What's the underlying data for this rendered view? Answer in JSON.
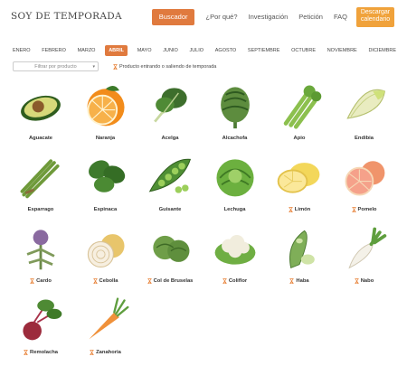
{
  "header": {
    "logo": "SOY DE TEMPORADA",
    "nav": {
      "search": "Buscador",
      "why": "¿Por qué?",
      "research": "Investigación",
      "petition": "Petición",
      "faq": "FAQ",
      "download": "Descargar calendario"
    }
  },
  "months": [
    "ENERO",
    "FEBRERO",
    "MARZO",
    "ABRIL",
    "MAYO",
    "JUNIO",
    "JULIO",
    "AGOSTO",
    "SEPTIEMBRE",
    "OCTUBRE",
    "NOVIEMBRE",
    "DICIEMBRE"
  ],
  "active_month": "ABRIL",
  "filter": {
    "placeholder": "Filtrar por producto"
  },
  "legend": {
    "text": "Producto entrando o saliendo de temporada"
  },
  "products": [
    {
      "name": "Aguacate",
      "transition": false,
      "icon": "avocado-icon"
    },
    {
      "name": "Naranja",
      "transition": false,
      "icon": "orange-icon"
    },
    {
      "name": "Acelga",
      "transition": false,
      "icon": "chard-icon"
    },
    {
      "name": "Alcachofa",
      "transition": false,
      "icon": "artichoke-icon"
    },
    {
      "name": "Apio",
      "transition": false,
      "icon": "celery-icon"
    },
    {
      "name": "Endibia",
      "transition": false,
      "icon": "endive-icon"
    },
    {
      "name": "Esparrago",
      "transition": false,
      "icon": "asparagus-icon"
    },
    {
      "name": "Espinaca",
      "transition": false,
      "icon": "spinach-icon"
    },
    {
      "name": "Guisante",
      "transition": false,
      "icon": "pea-icon"
    },
    {
      "name": "Lechuga",
      "transition": false,
      "icon": "lettuce-icon"
    },
    {
      "name": "Limón",
      "transition": true,
      "icon": "lemon-icon"
    },
    {
      "name": "Pomelo",
      "transition": true,
      "icon": "grapefruit-icon"
    },
    {
      "name": "Cardo",
      "transition": true,
      "icon": "thistle-icon"
    },
    {
      "name": "Cebolla",
      "transition": true,
      "icon": "onion-icon"
    },
    {
      "name": "Col de Bruselas",
      "transition": true,
      "icon": "brussels-sprouts-icon"
    },
    {
      "name": "Coliflor",
      "transition": true,
      "icon": "cauliflower-icon"
    },
    {
      "name": "Haba",
      "transition": true,
      "icon": "broad-bean-icon"
    },
    {
      "name": "Nabo",
      "transition": true,
      "icon": "turnip-icon"
    },
    {
      "name": "Remolacha",
      "transition": true,
      "icon": "beetroot-icon"
    },
    {
      "name": "Zanahoria",
      "transition": true,
      "icon": "carrot-icon"
    }
  ]
}
